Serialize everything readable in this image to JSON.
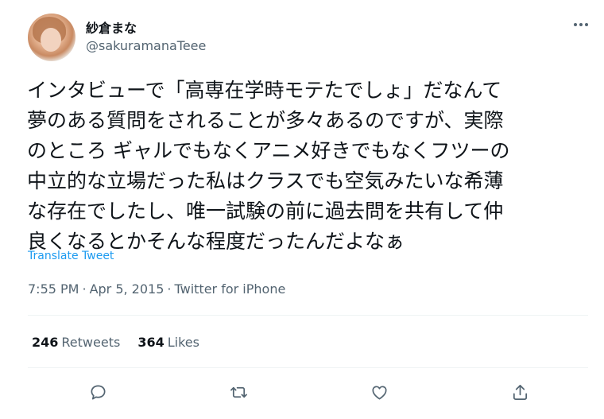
{
  "author": {
    "display_name": "紗倉まな",
    "handle": "@sakuramanaTeee"
  },
  "tweet": {
    "text": "インタビューで「高専在学時モテたでしょ」だなんて\n夢のある質問をされることが多々あるのですが、実際\nのところ ギャルでもなくアニメ好きでもなくフツーの\n中立的な立場だった私はクラスでも空気みたいな希薄\nな存在でしたし、唯一試験の前に過去問を共有して仲\n良くなるとかそんな程度だったんだよなぁ",
    "translate_label": "Translate Tweet",
    "time": "7:55 PM",
    "date": "Apr 5, 2015",
    "source": "Twitter for iPhone",
    "separator": "·"
  },
  "stats": {
    "retweets_count": "246",
    "retweets_label": "Retweets",
    "likes_count": "364",
    "likes_label": "Likes"
  },
  "actions": [
    "reply-icon",
    "retweet-icon",
    "like-icon",
    "share-icon"
  ],
  "colors": {
    "text": "#0f1419",
    "secondary": "#536471",
    "link": "#1d9bf0",
    "divider": "#eff3f4"
  }
}
